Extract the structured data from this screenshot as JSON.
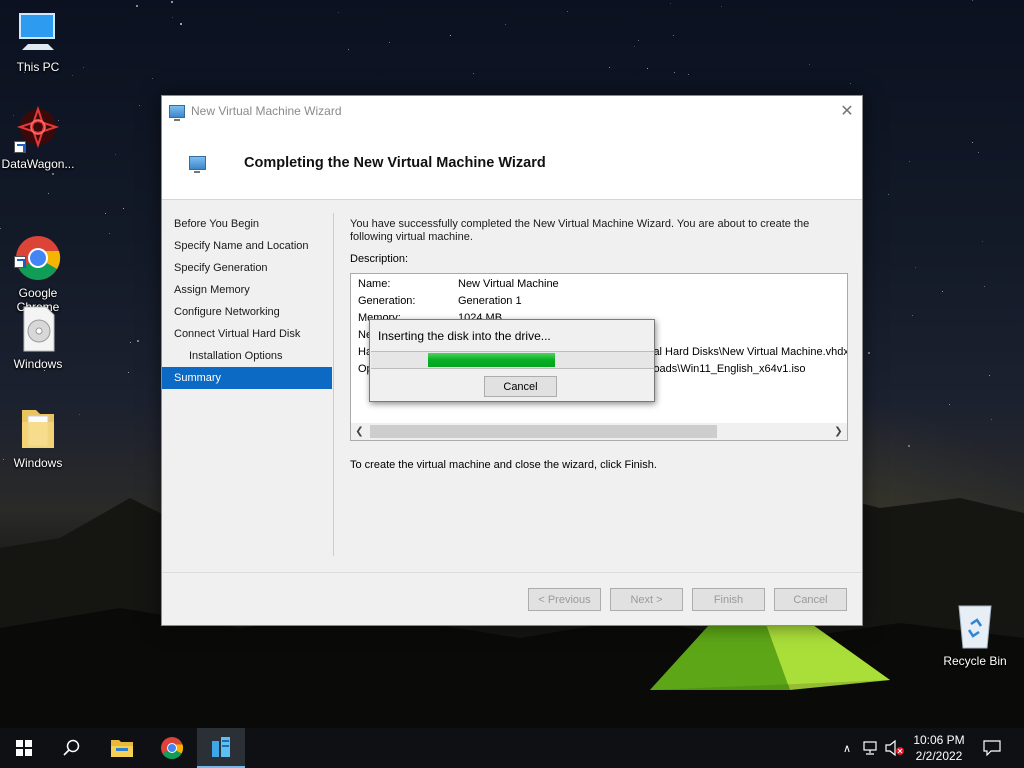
{
  "desktop": {
    "icons": [
      {
        "label": "This PC",
        "icon": "computer-icon"
      },
      {
        "label": "DataWagon...",
        "icon": "datawagon-icon"
      },
      {
        "label": "Google\nChrome",
        "icon": "chrome-icon"
      },
      {
        "label": "Windows",
        "icon": "disc-image-icon"
      },
      {
        "label": "Windows",
        "icon": "folder-icon"
      },
      {
        "label": "Recycle Bin",
        "icon": "recycle-bin-icon"
      }
    ]
  },
  "wizard": {
    "window_title": "New Virtual Machine Wizard",
    "heading": "Completing the New Virtual Machine Wizard",
    "nav": [
      {
        "label": "Before You Begin",
        "sub": false,
        "selected": false
      },
      {
        "label": "Specify Name and Location",
        "sub": false,
        "selected": false
      },
      {
        "label": "Specify Generation",
        "sub": false,
        "selected": false
      },
      {
        "label": "Assign Memory",
        "sub": false,
        "selected": false
      },
      {
        "label": "Configure Networking",
        "sub": false,
        "selected": false
      },
      {
        "label": "Connect Virtual Hard Disk",
        "sub": false,
        "selected": false
      },
      {
        "label": "Installation Options",
        "sub": true,
        "selected": false
      },
      {
        "label": "Summary",
        "sub": false,
        "selected": true
      }
    ],
    "intro": "You have successfully completed the New Virtual Machine Wizard. You are about to create the following virtual machine.",
    "description_label": "Description:",
    "description_rows": [
      {
        "key": "Name:",
        "value": "New Virtual Machine"
      },
      {
        "key": "Generation:",
        "value": "Generation 1"
      },
      {
        "key": "Memory:",
        "value": "1024 MB"
      },
      {
        "key": "Ne",
        "value": ""
      },
      {
        "key": "Ha",
        "value": "ial Hard Disks\\New Virtual Machine.vhdx"
      },
      {
        "key": "Op",
        "value": "loads\\Win11_English_x64v1.iso"
      }
    ],
    "finish_text": "To create the virtual machine and close the wizard, click Finish.",
    "buttons": {
      "previous": "< Previous",
      "next": "Next >",
      "finish": "Finish",
      "cancel": "Cancel"
    }
  },
  "progress_dialog": {
    "message": "Inserting the disk into the drive...",
    "cancel": "Cancel",
    "fill_start_fraction": 0.2,
    "fill_fraction": 0.45,
    "color": "#06b025"
  },
  "taskbar": {
    "time": "10:06 PM",
    "date": "2/2/2022",
    "accent": "#76b9ed"
  }
}
